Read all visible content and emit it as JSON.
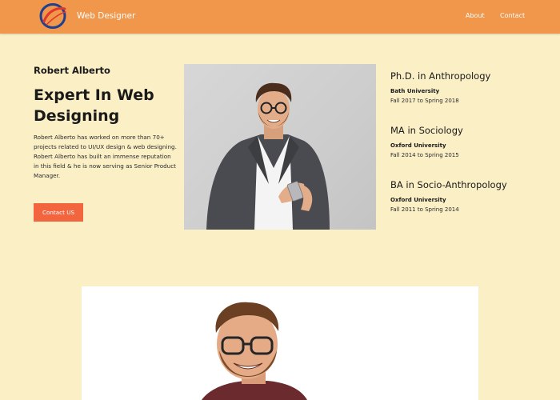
{
  "header": {
    "brand": "Web Designer",
    "nav": [
      {
        "label": "About"
      },
      {
        "label": "Contact"
      }
    ]
  },
  "hero": {
    "name": "Robert Alberto",
    "title": "Expert In Web Designing",
    "bio": "Robert Alberto has worked on more than 70+ projects  related to UI/UX design & web designing. Robert Alberto has built an immense reputation in this field & he is now serving as Senior Product Manager.",
    "cta_label": "Contact US"
  },
  "education": [
    {
      "degree": "Ph.D. in Anthropology",
      "school": "Bath University",
      "dates": " Fall 2017 to Spring 2018"
    },
    {
      "degree": "MA in Sociology",
      "school": "Oxford University",
      "dates": "Fall 2014 to Spring 2015"
    },
    {
      "degree": "BA in Socio-Anthropology",
      "school": "Oxford University",
      "dates": " Fall 2011 to Spring 2014"
    }
  ],
  "colors": {
    "header_bg": "#f0974c",
    "page_bg": "#fbefc6",
    "cta_bg": "#f2653e",
    "logo_blue": "#1f3f8f",
    "logo_red": "#e0392b"
  }
}
